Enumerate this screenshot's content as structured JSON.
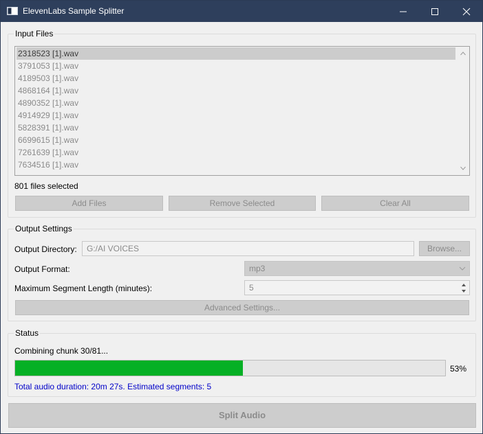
{
  "window": {
    "title": "ElevenLabs Sample Splitter",
    "titlebar_color": "#2e3f5c"
  },
  "input_files": {
    "group_title": "Input Files",
    "files": [
      "2318523 [1].wav",
      "3791053 [1].wav",
      "4189503 [1].wav",
      "4868164 [1].wav",
      "4890352 [1].wav",
      "4914929 [1].wav",
      "5828391 [1].wav",
      "6699615 [1].wav",
      "7261639 [1].wav",
      "7634516 [1].wav"
    ],
    "selected_index": 0,
    "files_selected_text": "801 files selected",
    "add_files_label": "Add Files",
    "remove_selected_label": "Remove Selected",
    "clear_all_label": "Clear All"
  },
  "output_settings": {
    "group_title": "Output Settings",
    "output_directory_label": "Output Directory:",
    "output_directory_value": "G:/AI VOICES",
    "browse_label": "Browse...",
    "output_format_label": "Output Format:",
    "output_format_value": "mp3",
    "max_segment_label": "Maximum Segment Length (minutes):",
    "max_segment_value": "5",
    "advanced_settings_label": "Advanced Settings..."
  },
  "status": {
    "group_title": "Status",
    "message": "Combining chunk 30/81...",
    "progress_percent": 53,
    "progress_label": "53%",
    "progress_color": "#06b025",
    "duration_text": "Total audio duration: 20m 27s. Estimated segments: 5",
    "duration_color": "#0000c8"
  },
  "actions": {
    "split_audio_label": "Split Audio"
  }
}
